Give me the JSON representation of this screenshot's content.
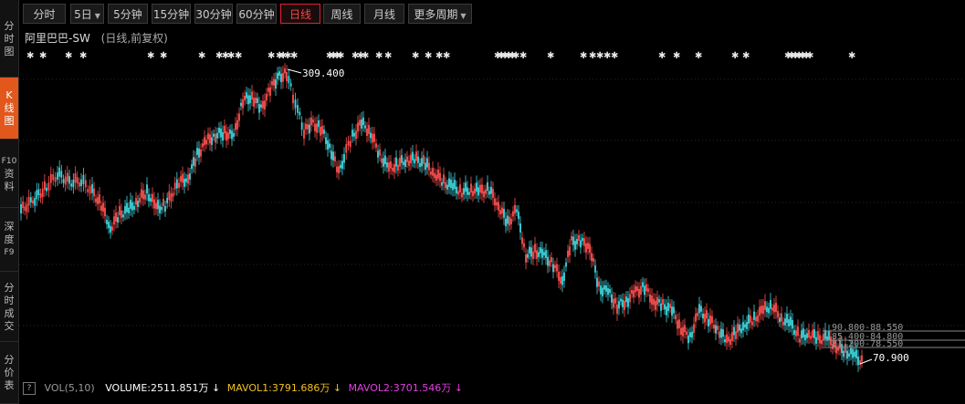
{
  "sidebar": {
    "items": [
      {
        "label": [
          "分",
          "时",
          "图"
        ],
        "active": false
      },
      {
        "label": [
          "K",
          "线",
          "图"
        ],
        "active": true
      },
      {
        "label": [
          "F10",
          "资",
          "料"
        ],
        "active": false
      },
      {
        "label": [
          "深",
          "度",
          "F9"
        ],
        "active": false
      },
      {
        "label": [
          "分",
          "时",
          "成",
          "交"
        ],
        "active": false
      },
      {
        "label": [
          "分",
          "价",
          "表"
        ],
        "active": false
      }
    ]
  },
  "tabs": [
    {
      "label": "分时"
    },
    {
      "label": "5日",
      "dropdown": true
    },
    {
      "label": "5分钟"
    },
    {
      "label": "15分钟"
    },
    {
      "label": "30分钟"
    },
    {
      "label": "60分钟"
    },
    {
      "label": "日线",
      "active": true
    },
    {
      "label": "周线"
    },
    {
      "label": "月线"
    },
    {
      "label": "更多周期",
      "dropdown": true
    }
  ],
  "title": {
    "name": "阿里巴巴-SW",
    "sub": "(日线,前复权)"
  },
  "chart_data": {
    "type": "candlestick",
    "high_label": "309.400",
    "low_label": "70.900",
    "price_levels": [
      "90.800-88.550",
      "85.400-84.800",
      "81.200-78.550"
    ],
    "colors": {
      "up": "#ff5050",
      "down": "#40d8e0",
      "grid": "#3a2020",
      "label": "#ffffff"
    }
  },
  "volume": {
    "help": "?",
    "name": "VOL(5,10)",
    "volume_label": "VOLUME:",
    "volume_value": "2511.851万",
    "mavol1_label": "MAVOL1:",
    "mavol1_value": "3791.686万",
    "mavol2_label": "MAVOL2:",
    "mavol2_value": "3701.546万",
    "arrow": "↓"
  },
  "icons": {
    "marker": "star-marker-icon",
    "caret": "caret-down-icon"
  }
}
